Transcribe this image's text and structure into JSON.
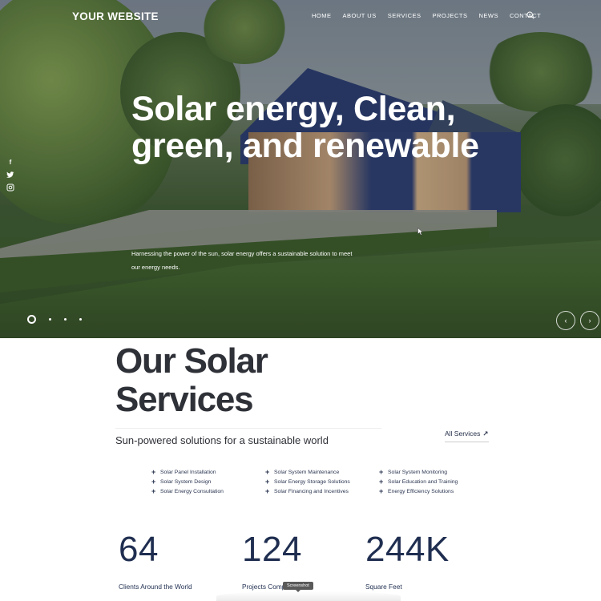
{
  "header": {
    "logo": "YOUR WEBSITE",
    "nav": [
      "HOME",
      "ABOUT US",
      "SERVICES",
      "PROJECTS",
      "NEWS",
      "CONTACT"
    ],
    "search_icon": "search-icon"
  },
  "social": {
    "icons": [
      "facebook-icon",
      "twitter-icon",
      "instagram-icon"
    ],
    "glyphs": [
      "f",
      "🐦",
      "◎"
    ]
  },
  "hero": {
    "title": "Solar energy, Clean, green, and renewable",
    "subtitle": "Harnessing the power of the sun, solar energy offers a sustainable solution to meet our energy needs.",
    "slider": {
      "total_slides": 4,
      "active_slide": 1
    },
    "prev_glyph": "‹",
    "next_glyph": "›"
  },
  "services": {
    "title_line1": "Our Solar",
    "title_line2": "Services",
    "subtitle": "Sun-powered solutions for a sustainable world",
    "all_services_label": "All Services",
    "all_services_arrow": "↗",
    "columns": [
      [
        "Solar Panel Installation",
        "Solar System Design",
        "Solar Energy Consultation"
      ],
      [
        "Solar System Maintenance",
        "Solar Energy Storage Solutions",
        "Solar Financing and Incentives"
      ],
      [
        "Solar System Monitoring",
        "Solar Education and Training",
        "Energy Efficiency Solutions"
      ]
    ],
    "plus_glyph": "+"
  },
  "stats": [
    {
      "value": "64",
      "label": "Clients Around the World"
    },
    {
      "value": "124",
      "label": "Projects Completed"
    },
    {
      "value": "244K",
      "label": "Square Feet"
    }
  ],
  "overlay": {
    "tooltip": "Screenshot",
    "stat2_visible_label": "Projects Comp"
  },
  "colors": {
    "heading": "#2f3138",
    "stat_navy": "#1f2e50",
    "house_blue": "#2c3d6e"
  }
}
